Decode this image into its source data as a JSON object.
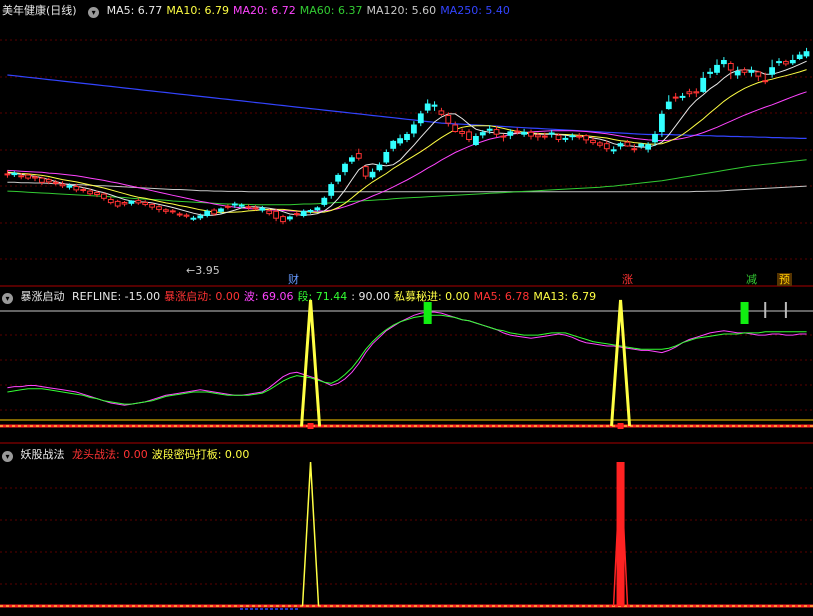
{
  "panel1": {
    "title": "美年健康(日线)",
    "legend": [
      {
        "label": "MA5: 6.77",
        "color": "#e8e8e8"
      },
      {
        "label": "MA10: 6.79",
        "color": "#ffff44"
      },
      {
        "label": "MA20: 6.72",
        "color": "#ff44ff"
      },
      {
        "label": "MA60: 6.37",
        "color": "#33cc33"
      },
      {
        "label": "MA120: 5.60",
        "color": "#c8c8c8"
      },
      {
        "label": "MA250: 5.40",
        "color": "#3344ff"
      }
    ],
    "low_annotation": "3.95",
    "event_markers": [
      {
        "text": "财",
        "color": "#6699ff"
      },
      {
        "text": "涨",
        "color": "#ff3333"
      },
      {
        "text": "减",
        "color": "#33cc33"
      },
      {
        "text": "预",
        "color": "#ffcc00"
      }
    ]
  },
  "panel2": {
    "title": "暴涨启动",
    "legend": [
      {
        "label": "REFLINE: -15.00",
        "color": "#e8e8e8"
      },
      {
        "label": "暴涨启动: 0.00",
        "color": "#ff3333"
      },
      {
        "label": "波: 69.06",
        "color": "#ff44ff"
      },
      {
        "label": "段: 71.44",
        "color": "#33ff33"
      },
      {
        "label": ": 90.00",
        "color": "#e8e8e8"
      },
      {
        "label": "私募秘进: 0.00",
        "color": "#ffff44"
      },
      {
        "label": "MA5: 6.78",
        "color": "#ff3333"
      },
      {
        "label": "MA13: 6.79",
        "color": "#ffff44"
      }
    ]
  },
  "panel3": {
    "title": "妖股战法",
    "legend": [
      {
        "label": "龙头战法: 0.00",
        "color": "#ff3333"
      },
      {
        "label": "波段密码打板: 0.00",
        "color": "#ffff44"
      }
    ]
  },
  "chart_data": {
    "type": "candlestick",
    "up_color": "#ff3333",
    "down_color": "#33ffff",
    "close": [
      6.27,
      6.25,
      6.22,
      6.24,
      6.19,
      6.16,
      6.12,
      6.05,
      6.0,
      5.92,
      5.94,
      5.86,
      5.82,
      5.78,
      5.74,
      5.6,
      5.55,
      5.52,
      5.5,
      5.57,
      5.52,
      5.47,
      5.41,
      5.33,
      5.3,
      5.22,
      5.19,
      5.1,
      5.12,
      5.18,
      5.32,
      5.29,
      5.42,
      5.46,
      5.44,
      5.41,
      5.38,
      5.32,
      5.3,
      5.29,
      5.15,
      5.09,
      5.23,
      5.18,
      5.3,
      5.33,
      5.47,
      5.71,
      6.08,
      6.33,
      6.6,
      6.8,
      6.46,
      6.19,
      6.38,
      6.58,
      6.94,
      7.08,
      7.17,
      7.34,
      7.61,
      7.94,
      8.04,
      7.92,
      7.8,
      7.55,
      7.38,
      7.37,
      7.04,
      7.29,
      7.41,
      7.43,
      7.26,
      7.28,
      7.39,
      7.31,
      7.36,
      7.29,
      7.26,
      7.33,
      7.28,
      7.19,
      7.26,
      7.26,
      7.27,
      7.15,
      7.08,
      7.06,
      6.87,
      7.0,
      7.1,
      6.93,
      7.0,
      6.92,
      7.11,
      7.38,
      7.98,
      8.28,
      8.29,
      8.42,
      8.42,
      8.43,
      8.9,
      8.93,
      9.16,
      9.16,
      8.86,
      8.99,
      8.93,
      8.94,
      8.71,
      8.88,
      9.2,
      9.21,
      9.18,
      9.29,
      9.36
    ],
    "open": [
      6.25,
      6.29,
      6.2,
      6.16,
      6.16,
      6.05,
      6.06,
      6.03,
      5.96,
      5.96,
      5.85,
      5.84,
      5.75,
      5.73,
      5.63,
      5.52,
      5.43,
      5.48,
      5.56,
      5.51,
      5.47,
      5.4,
      5.34,
      5.29,
      5.29,
      5.21,
      5.16,
      5.11,
      5.17,
      5.29,
      5.22,
      5.35,
      5.4,
      5.48,
      5.45,
      5.41,
      5.37,
      5.37,
      5.23,
      5.11,
      5.02,
      5.14,
      5.21,
      5.29,
      5.31,
      5.38,
      5.63,
      5.99,
      6.23,
      6.52,
      6.69,
      6.68,
      6.21,
      6.31,
      6.5,
      6.83,
      7.12,
      7.19,
      7.3,
      7.55,
      7.84,
      8.1,
      8.07,
      7.83,
      7.6,
      7.38,
      7.33,
      7.17,
      7.25,
      7.35,
      7.44,
      7.31,
      7.24,
      7.37,
      7.39,
      7.36,
      7.26,
      7.24,
      7.25,
      7.34,
      7.17,
      7.2,
      7.27,
      7.24,
      7.16,
      7.09,
      7.02,
      6.93,
      6.9,
      7.06,
      7.0,
      6.92,
      7.05,
      7.03,
      7.3,
      7.83,
      8.15,
      8.28,
      8.3,
      8.37,
      8.39,
      8.77,
      8.93,
      9.11,
      9.24,
      8.99,
      8.95,
      8.93,
      8.98,
      8.83,
      8.71,
      9.05,
      9.21,
      9.15,
      9.24,
      9.38,
      9.47
    ],
    "high": [
      6.37,
      6.34,
      6.29,
      6.27,
      6.23,
      6.2,
      6.17,
      6.11,
      6.08,
      6.02,
      6.01,
      5.91,
      5.88,
      5.83,
      5.78,
      5.67,
      5.59,
      5.56,
      5.58,
      5.63,
      5.58,
      5.51,
      5.46,
      5.37,
      5.35,
      5.27,
      5.24,
      5.17,
      5.23,
      5.34,
      5.37,
      5.39,
      5.47,
      5.54,
      5.5,
      5.47,
      5.45,
      5.43,
      5.35,
      5.36,
      5.2,
      5.18,
      5.29,
      5.34,
      5.35,
      5.42,
      5.68,
      6.05,
      6.29,
      6.57,
      6.76,
      6.93,
      6.49,
      6.41,
      6.57,
      6.91,
      7.16,
      7.3,
      7.37,
      7.65,
      7.92,
      8.22,
      8.17,
      8.0,
      7.88,
      7.64,
      7.46,
      7.44,
      7.33,
      7.42,
      7.54,
      7.52,
      7.32,
      7.44,
      7.48,
      7.45,
      7.43,
      7.35,
      7.35,
      7.42,
      7.33,
      7.27,
      7.33,
      7.34,
      7.31,
      7.24,
      7.13,
      7.14,
      6.99,
      7.11,
      7.16,
      7.05,
      7.08,
      7.1,
      7.39,
      7.93,
      8.33,
      8.39,
      8.39,
      8.5,
      8.51,
      8.94,
      9.04,
      9.27,
      9.33,
      9.22,
      9.08,
      9.06,
      9.08,
      8.97,
      8.92,
      9.26,
      9.3,
      9.26,
      9.39,
      9.47,
      9.57
    ],
    "low": [
      6.17,
      6.19,
      6.13,
      6.11,
      6.08,
      5.98,
      6.0,
      5.97,
      5.9,
      5.86,
      5.79,
      5.78,
      5.69,
      5.66,
      5.57,
      5.47,
      5.38,
      5.42,
      5.44,
      5.46,
      5.42,
      5.33,
      5.26,
      5.22,
      5.22,
      5.14,
      5.11,
      5.04,
      5.06,
      5.13,
      5.17,
      5.23,
      5.34,
      5.38,
      5.37,
      5.33,
      5.31,
      5.26,
      5.18,
      5.03,
      4.95,
      5.03,
      5.15,
      5.13,
      5.23,
      5.28,
      5.41,
      5.62,
      6.0,
      6.23,
      6.53,
      6.62,
      6.13,
      6.13,
      6.33,
      6.53,
      6.86,
      7.01,
      7.1,
      7.23,
      7.52,
      7.86,
      7.92,
      7.79,
      7.51,
      7.35,
      7.24,
      7.1,
      7.0,
      7.2,
      7.32,
      7.23,
      7.12,
      7.18,
      7.3,
      7.24,
      7.17,
      7.14,
      7.17,
      7.22,
      7.1,
      7.1,
      7.15,
      7.17,
      7.06,
      7.03,
      6.96,
      6.85,
      6.79,
      6.91,
      6.98,
      6.83,
      6.93,
      6.83,
      7.0,
      7.24,
      7.95,
      8.16,
      8.19,
      8.28,
      8.28,
      8.39,
      8.78,
      8.86,
      9.06,
      8.75,
      8.76,
      8.85,
      8.82,
      8.7,
      8.62,
      8.79,
      9.1,
      9.09,
      9.12,
      9.25,
      9.3
    ],
    "ma5": [
      6.3,
      6.28,
      6.26,
      6.23,
      6.21,
      6.17,
      6.12,
      6.07,
      6.02,
      5.98,
      5.95,
      5.91,
      5.87,
      5.82,
      5.78,
      5.72,
      5.66,
      5.6,
      5.56,
      5.54,
      5.53,
      5.51,
      5.47,
      5.43,
      5.39,
      5.34,
      5.29,
      5.24,
      5.2,
      5.18,
      5.19,
      5.22,
      5.27,
      5.32,
      5.38,
      5.41,
      5.41,
      5.39,
      5.37,
      5.34,
      5.28,
      5.22,
      5.2,
      5.19,
      5.2,
      5.23,
      5.3,
      5.43,
      5.62,
      5.85,
      6.12,
      6.38,
      6.5,
      6.53,
      6.5,
      6.48,
      6.51,
      6.63,
      6.83,
      7.02,
      7.23,
      7.43,
      7.63,
      7.76,
      7.84,
      7.84,
      7.72,
      7.57,
      7.44,
      7.39,
      7.36,
      7.34,
      7.33,
      7.32,
      7.34,
      7.33,
      7.32,
      7.31,
      7.31,
      7.31,
      7.3,
      7.28,
      7.26,
      7.25,
      7.24,
      7.21,
      7.18,
      7.13,
      7.06,
      7.02,
      7.01,
      6.99,
      6.97,
      6.97,
      7.02,
      7.1,
      7.29,
      7.53,
      7.77,
      8.01,
      8.2,
      8.34,
      8.5,
      8.62,
      8.78,
      8.91,
      8.98,
      9.0,
      8.98,
      8.95,
      8.88,
      8.88,
      8.93,
      8.99,
      9.06,
      9.14,
      9.22
    ],
    "ma10": [
      6.32,
      6.3,
      6.28,
      6.27,
      6.25,
      6.23,
      6.2,
      6.16,
      6.12,
      6.09,
      6.06,
      6.02,
      5.98,
      5.94,
      5.9,
      5.85,
      5.8,
      5.75,
      5.7,
      5.66,
      5.63,
      5.59,
      5.55,
      5.51,
      5.48,
      5.44,
      5.41,
      5.37,
      5.33,
      5.3,
      5.27,
      5.26,
      5.26,
      5.27,
      5.28,
      5.3,
      5.31,
      5.33,
      5.34,
      5.34,
      5.34,
      5.32,
      5.3,
      5.28,
      5.27,
      5.26,
      5.27,
      5.31,
      5.39,
      5.5,
      5.64,
      5.79,
      5.93,
      6.06,
      6.17,
      6.28,
      6.41,
      6.52,
      6.63,
      6.74,
      6.85,
      6.97,
      7.1,
      7.22,
      7.33,
      7.43,
      7.49,
      7.52,
      7.53,
      7.53,
      7.53,
      7.5,
      7.46,
      7.42,
      7.39,
      7.36,
      7.34,
      7.33,
      7.32,
      7.32,
      7.31,
      7.3,
      7.29,
      7.28,
      7.27,
      7.25,
      7.23,
      7.21,
      7.17,
      7.14,
      7.12,
      7.09,
      7.07,
      7.05,
      7.05,
      7.06,
      7.12,
      7.2,
      7.3,
      7.43,
      7.57,
      7.71,
      7.87,
      8.02,
      8.17,
      8.3,
      8.41,
      8.51,
      8.59,
      8.66,
      8.71,
      8.75,
      8.8,
      8.84,
      8.89,
      8.94,
      9.0
    ],
    "ma20": [
      6.36,
      6.35,
      6.34,
      6.33,
      6.32,
      6.31,
      6.29,
      6.28,
      6.26,
      6.24,
      6.22,
      6.19,
      6.16,
      6.13,
      6.1,
      6.06,
      6.03,
      5.99,
      5.95,
      5.91,
      5.87,
      5.83,
      5.79,
      5.75,
      5.71,
      5.67,
      5.63,
      5.59,
      5.55,
      5.52,
      5.48,
      5.45,
      5.42,
      5.4,
      5.38,
      5.36,
      5.35,
      5.34,
      5.33,
      5.32,
      5.31,
      5.3,
      5.29,
      5.29,
      5.29,
      5.29,
      5.3,
      5.32,
      5.36,
      5.41,
      5.47,
      5.54,
      5.61,
      5.69,
      5.76,
      5.84,
      5.93,
      6.02,
      6.11,
      6.21,
      6.31,
      6.42,
      6.52,
      6.63,
      6.73,
      6.83,
      6.91,
      6.99,
      7.06,
      7.12,
      7.18,
      7.22,
      7.26,
      7.3,
      7.33,
      7.35,
      7.37,
      7.38,
      7.39,
      7.4,
      7.4,
      7.4,
      7.4,
      7.39,
      7.38,
      7.36,
      7.34,
      7.32,
      7.29,
      7.26,
      7.23,
      7.2,
      7.18,
      7.16,
      7.15,
      7.14,
      7.15,
      7.17,
      7.2,
      7.24,
      7.29,
      7.35,
      7.42,
      7.49,
      7.57,
      7.65,
      7.73,
      7.81,
      7.88,
      7.95,
      8.02,
      8.08,
      8.15,
      8.22,
      8.29,
      8.36,
      8.42
    ],
    "ma60": [
      5.82,
      5.81,
      5.8,
      5.79,
      5.78,
      5.77,
      5.76,
      5.75,
      5.74,
      5.73,
      5.72,
      5.71,
      5.7,
      5.69,
      5.68,
      5.67,
      5.66,
      5.65,
      5.63,
      5.62,
      5.61,
      5.6,
      5.59,
      5.58,
      5.56,
      5.55,
      5.54,
      5.53,
      5.52,
      5.51,
      5.5,
      5.49,
      5.48,
      5.48,
      5.47,
      5.47,
      5.46,
      5.46,
      5.46,
      5.46,
      5.46,
      5.46,
      5.47,
      5.48,
      5.48,
      5.49,
      5.5,
      5.51,
      5.52,
      5.53,
      5.55,
      5.56,
      5.57,
      5.58,
      5.59,
      5.6,
      5.62,
      5.63,
      5.64,
      5.65,
      5.66,
      5.67,
      5.68,
      5.69,
      5.7,
      5.71,
      5.72,
      5.73,
      5.74,
      5.75,
      5.76,
      5.77,
      5.78,
      5.79,
      5.8,
      5.81,
      5.82,
      5.83,
      5.84,
      5.85,
      5.86,
      5.87,
      5.88,
      5.89,
      5.9,
      5.91,
      5.92,
      5.94,
      5.95,
      5.97,
      5.99,
      6.01,
      6.03,
      6.05,
      6.07,
      6.09,
      6.12,
      6.15,
      6.18,
      6.21,
      6.24,
      6.27,
      6.3,
      6.33,
      6.36,
      6.39,
      6.42,
      6.45,
      6.48,
      6.5,
      6.52,
      6.54,
      6.56,
      6.58,
      6.6,
      6.62,
      6.64
    ],
    "ma120": [
      6.05,
      6.05,
      6.04,
      6.04,
      6.03,
      6.03,
      6.02,
      6.01,
      6.01,
      6.0,
      5.99,
      5.98,
      5.97,
      5.96,
      5.96,
      5.95,
      5.94,
      5.93,
      5.92,
      5.91,
      5.9,
      5.89,
      5.88,
      5.87,
      5.86,
      5.86,
      5.85,
      5.84,
      5.83,
      5.83,
      5.82,
      5.82,
      5.81,
      5.81,
      5.81,
      5.8,
      5.8,
      5.8,
      5.8,
      5.8,
      5.8,
      5.8,
      5.8,
      5.8,
      5.8,
      5.8,
      5.8,
      5.8,
      5.8,
      5.8,
      5.8,
      5.8,
      5.8,
      5.8,
      5.8,
      5.8,
      5.8,
      5.8,
      5.8,
      5.8,
      5.8,
      5.8,
      5.8,
      5.8,
      5.8,
      5.8,
      5.8,
      5.8,
      5.8,
      5.8,
      5.8,
      5.8,
      5.8,
      5.8,
      5.8,
      5.8,
      5.8,
      5.8,
      5.8,
      5.8,
      5.8,
      5.8,
      5.8,
      5.8,
      5.8,
      5.8,
      5.8,
      5.8,
      5.8,
      5.8,
      5.8,
      5.8,
      5.8,
      5.8,
      5.8,
      5.8,
      5.8,
      5.8,
      5.8,
      5.8,
      5.81,
      5.81,
      5.82,
      5.82,
      5.83,
      5.84,
      5.85,
      5.86,
      5.87,
      5.88,
      5.89,
      5.9,
      5.91,
      5.92,
      5.93,
      5.94,
      5.95
    ],
    "ma250": [
      8.86,
      8.84,
      8.82,
      8.8,
      8.78,
      8.76,
      8.74,
      8.72,
      8.7,
      8.68,
      8.66,
      8.64,
      8.62,
      8.6,
      8.58,
      8.56,
      8.54,
      8.52,
      8.5,
      8.48,
      8.46,
      8.44,
      8.42,
      8.4,
      8.38,
      8.36,
      8.34,
      8.32,
      8.3,
      8.28,
      8.26,
      8.24,
      8.22,
      8.2,
      8.18,
      8.16,
      8.14,
      8.12,
      8.1,
      8.08,
      8.06,
      8.04,
      8.02,
      8.0,
      7.98,
      7.96,
      7.94,
      7.92,
      7.9,
      7.88,
      7.86,
      7.84,
      7.82,
      7.8,
      7.78,
      7.76,
      7.74,
      7.72,
      7.7,
      7.68,
      7.66,
      7.64,
      7.62,
      7.6,
      7.59,
      7.58,
      7.57,
      7.56,
      7.55,
      7.54,
      7.53,
      7.52,
      7.51,
      7.5,
      7.49,
      7.48,
      7.47,
      7.46,
      7.45,
      7.44,
      7.43,
      7.42,
      7.41,
      7.4,
      7.39,
      7.38,
      7.37,
      7.36,
      7.35,
      7.34,
      7.33,
      7.32,
      7.31,
      7.3,
      7.3,
      7.3,
      7.3,
      7.29,
      7.29,
      7.28,
      7.28,
      7.27,
      7.27,
      7.26,
      7.26,
      7.25,
      7.25,
      7.24,
      7.24,
      7.23,
      7.23,
      7.22,
      7.22,
      7.21,
      7.21,
      7.2,
      7.2
    ],
    "bo": [
      20,
      21,
      21,
      22,
      22,
      21,
      20,
      19,
      18,
      17,
      16,
      14,
      12,
      10,
      8,
      6,
      5,
      4,
      5,
      6,
      7,
      9,
      11,
      13,
      14,
      15,
      16,
      17,
      18,
      17,
      16,
      15,
      14,
      13,
      13,
      14,
      15,
      16,
      20,
      25,
      30,
      33,
      34,
      32,
      30,
      28,
      25,
      22,
      24,
      28,
      34,
      42,
      52,
      60,
      66,
      72,
      76,
      80,
      83,
      86,
      88,
      89,
      89,
      88,
      86,
      84,
      82,
      81,
      79,
      77,
      75,
      73,
      70,
      68,
      67,
      66,
      65,
      66,
      67,
      68,
      69,
      68,
      66,
      63,
      61,
      60,
      59,
      58,
      58,
      57,
      56,
      55,
      54,
      54,
      53,
      52,
      54,
      57,
      61,
      64,
      66,
      68,
      70,
      71,
      72,
      71,
      70,
      70,
      69,
      68,
      68,
      69,
      69,
      68,
      68,
      69,
      69
    ],
    "duan": [
      16,
      17,
      18,
      19,
      19,
      19,
      18,
      17,
      16,
      15,
      14,
      13,
      11,
      10,
      8,
      7,
      6,
      5,
      5,
      6,
      7,
      8,
      10,
      12,
      13,
      14,
      15,
      16,
      16,
      16,
      15,
      14,
      13,
      13,
      13,
      13,
      14,
      15,
      18,
      22,
      26,
      29,
      31,
      30,
      29,
      27,
      25,
      24,
      27,
      32,
      38,
      46,
      55,
      62,
      68,
      73,
      77,
      80,
      82,
      84,
      85,
      86,
      86,
      86,
      85,
      84,
      82,
      81,
      79,
      77,
      75,
      73,
      72,
      70,
      69,
      68,
      68,
      68,
      69,
      70,
      70,
      70,
      68,
      66,
      64,
      62,
      61,
      60,
      59,
      58,
      57,
      56,
      55,
      55,
      55,
      55,
      56,
      58,
      61,
      63,
      65,
      66,
      67,
      68,
      69,
      69,
      69,
      70,
      70,
      70,
      71,
      71,
      71,
      71,
      71,
      71,
      71
    ],
    "spike_index": [
      44,
      89
    ],
    "limit_up_index": [
      89
    ],
    "flag_green_index": [
      61,
      107
    ],
    "flag_white_index": [
      110,
      113
    ],
    "refline": -15,
    "upper_ref": 90,
    "price_ylim": [
      3.7,
      10.3
    ],
    "ind_ylim": [
      -15,
      100
    ],
    "low_point_index": 25
  }
}
